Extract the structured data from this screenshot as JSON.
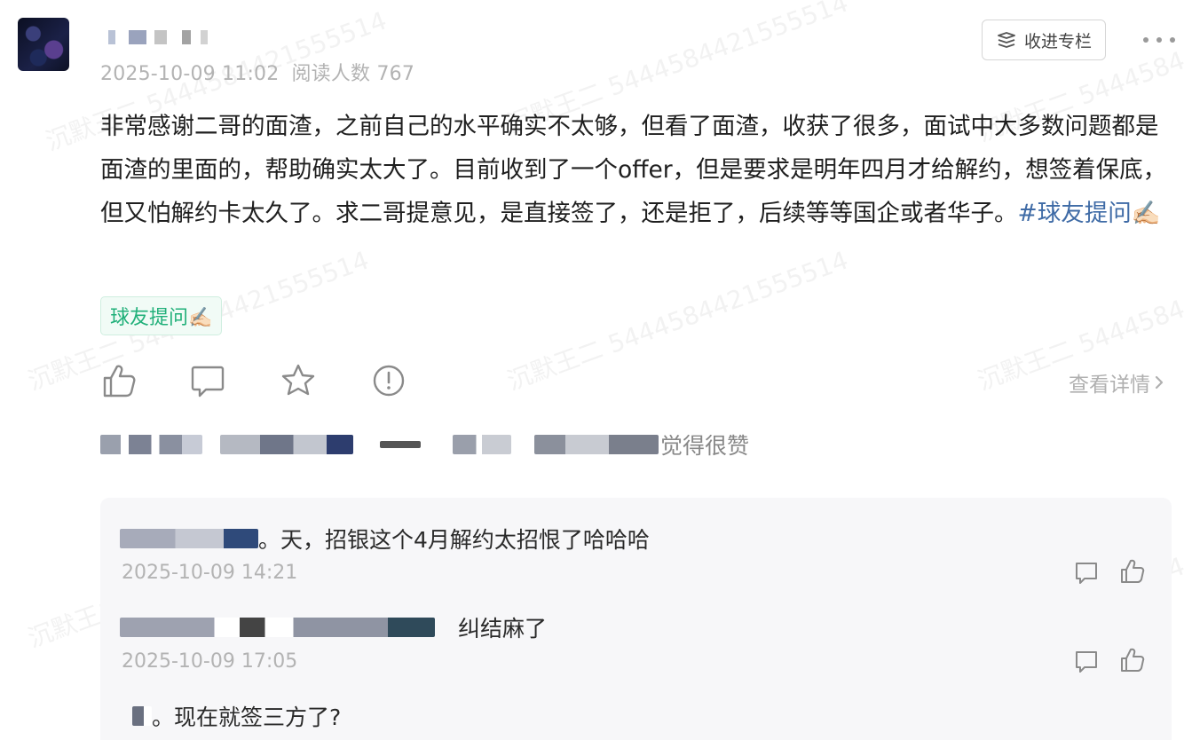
{
  "post": {
    "date": "2025-10-09 11:02",
    "reads": "阅读人数 767",
    "collect_label": "收进专栏",
    "body": "非常感谢二哥的面渣，之前自己的水平确实不太够，但看了面渣，收获了很多，面试中大多数问题都是面渣的里面的，帮助确实太大了。目前收到了一个offer，但是要求是明年四月才给解约，想签着保底，但又怕解约卡太久了。求二哥提意见，是直接签了，还是拒了，后续等等国企或者华子。",
    "hashtag": "#球友提问✍🏻",
    "tag": "球友提问✍🏻",
    "view_detail": "查看详情",
    "likes_suffix": "觉得很赞"
  },
  "watermark": "沉默王二 5444584421555514",
  "comments": [
    {
      "text": "。天，招银这个4月解约太招恨了哈哈哈",
      "time": "2025-10-09 14:21"
    },
    {
      "text": "纠结麻了",
      "time": "2025-10-09 17:05"
    },
    {
      "text": "。现在就签三方了?",
      "time": ""
    }
  ],
  "icons": [
    "like-icon",
    "comment-icon",
    "star-icon",
    "report-icon",
    "more-icon",
    "bookmark-icon",
    "chevron-right-icon"
  ],
  "colors": {
    "hashtag": "#3f6ba6",
    "tag_text": "#21b07a",
    "tag_bg": "#f1fbf6",
    "meta": "#b3b3b3"
  }
}
